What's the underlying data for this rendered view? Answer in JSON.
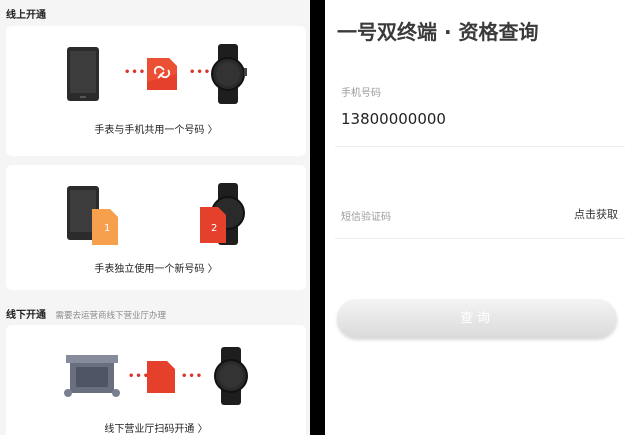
{
  "left": {
    "online_title": "线上开通",
    "online_card1_label": "手表与手机共用一个号码",
    "online_card2_label": "手表独立使用一个新号码",
    "sim_badge_1": "1",
    "sim_badge_2": "2",
    "offline_title": "线下开通",
    "offline_subtitle": "需要去运营商线下营业厅办理",
    "offline_card_label": "线下营业厅扫码开通",
    "chevron": "〉",
    "dots": "•••"
  },
  "right": {
    "title": "一号双终端 · 资格查询",
    "phone_label": "手机号码",
    "phone_value": "13800000000",
    "sms_label": "短信验证码",
    "get_code_label": "点击获取",
    "query_button": "查询"
  },
  "colors": {
    "accent": "#e8512a",
    "sim_orange": "#f6a04d",
    "link_red": "#e5402b",
    "watch_dark": "#1e1e1e"
  },
  "icons": [
    "phone-icon",
    "link-icon",
    "watch-icon",
    "sim-card-icon",
    "store-icon",
    "chevron-right-icon"
  ]
}
